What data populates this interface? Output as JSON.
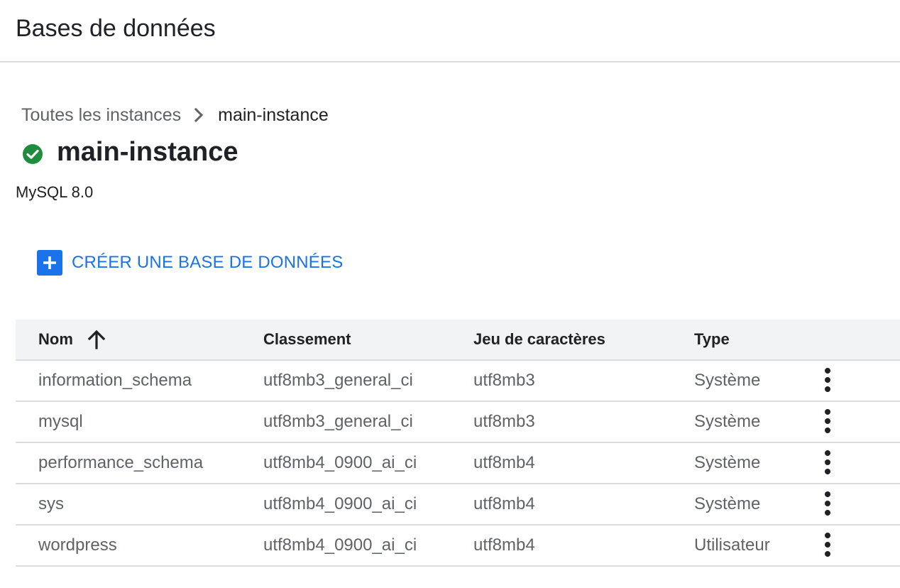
{
  "header": {
    "title": "Bases de données"
  },
  "breadcrumb": {
    "parent": "Toutes les instances",
    "current": "main-instance"
  },
  "instance": {
    "name": "main-instance",
    "status_icon": "check-circle-icon",
    "status_color": "#1e8e3e",
    "version": "MySQL 8.0"
  },
  "actions": {
    "create_label": "CRÉER UNE BASE DE DONNÉES",
    "accent_color": "#1a73e8"
  },
  "table": {
    "columns": {
      "name": "Nom",
      "collation": "Classement",
      "charset": "Jeu de caractères",
      "type": "Type"
    },
    "sort": {
      "column": "Nom",
      "direction": "ascending"
    },
    "rows": [
      {
        "name": "information_schema",
        "collation": "utf8mb3_general_ci",
        "charset": "utf8mb3",
        "type": "Système"
      },
      {
        "name": "mysql",
        "collation": "utf8mb3_general_ci",
        "charset": "utf8mb3",
        "type": "Système"
      },
      {
        "name": "performance_schema",
        "collation": "utf8mb4_0900_ai_ci",
        "charset": "utf8mb4",
        "type": "Système"
      },
      {
        "name": "sys",
        "collation": "utf8mb4_0900_ai_ci",
        "charset": "utf8mb4",
        "type": "Système"
      },
      {
        "name": "wordpress",
        "collation": "utf8mb4_0900_ai_ci",
        "charset": "utf8mb4",
        "type": "Utilisateur"
      }
    ]
  }
}
